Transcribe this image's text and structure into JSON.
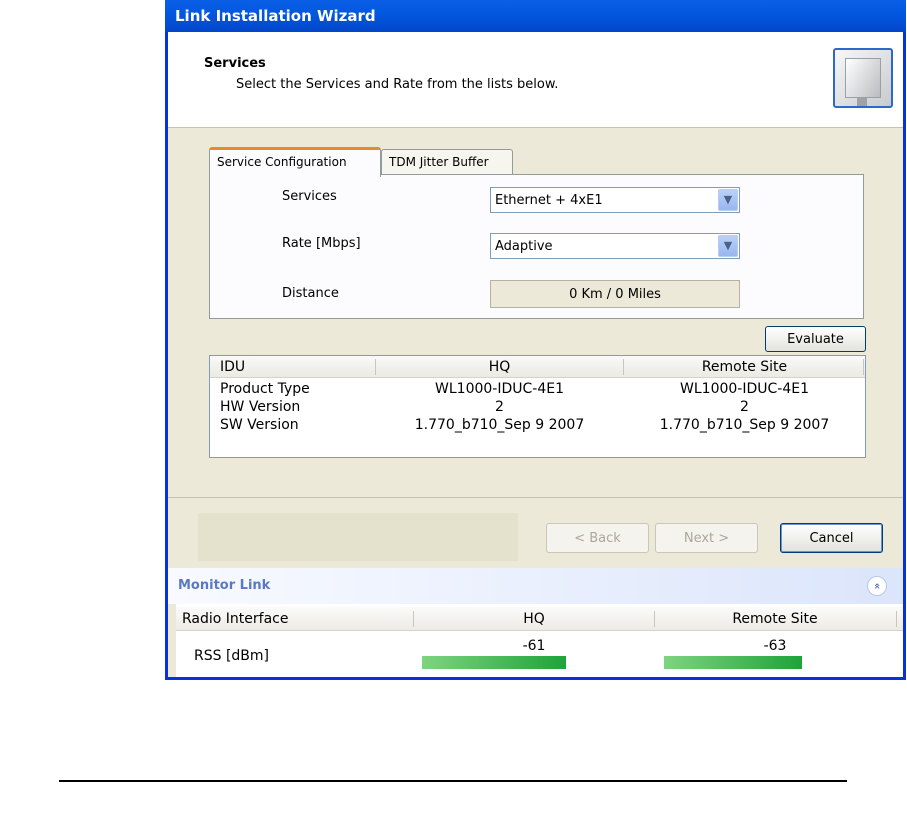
{
  "window": {
    "title": "Link Installation Wizard"
  },
  "header": {
    "title": "Services",
    "subtitle": "Select the Services and Rate from the lists below.",
    "art_icon": "antenna-panel-icon"
  },
  "tabs": [
    {
      "label": "Service Configuration",
      "active": true
    },
    {
      "label": "TDM Jitter Buffer",
      "active": false
    }
  ],
  "form": {
    "services_label": "Services",
    "services_value": "Ethernet + 4xE1",
    "rate_label": "Rate [Mbps]",
    "rate_value": "Adaptive",
    "distance_label": "Distance",
    "distance_value": "0 Km / 0 Miles",
    "evaluate_label": "Evaluate"
  },
  "info_table": {
    "headers": [
      "IDU",
      "HQ",
      "Remote Site"
    ],
    "rows": [
      [
        "Product Type",
        "WL1000-IDUC-4E1",
        "WL1000-IDUC-4E1"
      ],
      [
        "HW Version",
        "2",
        "2"
      ],
      [
        "SW Version",
        "1.770_b710_Sep  9 2007",
        "1.770_b710_Sep  9 2007"
      ]
    ]
  },
  "buttons": {
    "back": "< Back",
    "next": "Next >",
    "cancel": "Cancel"
  },
  "monitor": {
    "title": "Monitor Link",
    "collapse_glyph": "«",
    "headers": [
      "Radio Interface",
      "HQ",
      "Remote Site"
    ],
    "row_label": "RSS [dBm]",
    "hq_value": "-61",
    "remote_value": "-63",
    "bar_color": "#1ea33a"
  }
}
